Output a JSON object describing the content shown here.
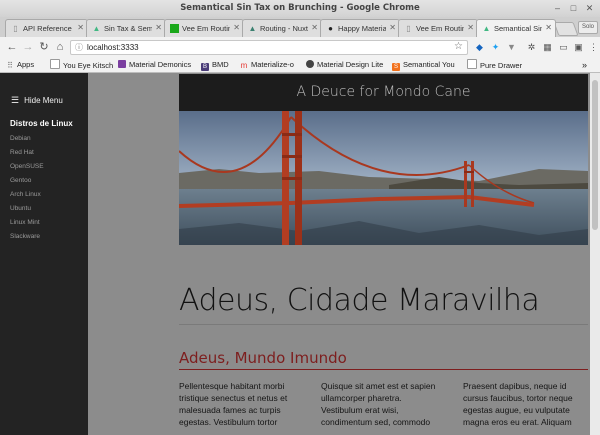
{
  "window": {
    "title": "Semantical Sin Tax on Brunching - Google Chrome"
  },
  "tabs": [
    {
      "label": "API Reference",
      "icon": "page-icon"
    },
    {
      "label": "Sin Tax & Semantics",
      "icon": "vue-icon"
    },
    {
      "label": "Vee Em Routing",
      "icon": "green-square-icon"
    },
    {
      "label": "Routing - Nuxt",
      "icon": "nuxt-icon"
    },
    {
      "label": "Happy Material",
      "icon": "github-icon"
    },
    {
      "label": "Vee Em Routing",
      "icon": "page-icon"
    },
    {
      "label": "Semantical Sin Tax",
      "icon": "vue-icon"
    }
  ],
  "profile_label": "Solo",
  "toolbar": {
    "url": "localhost:3333"
  },
  "bookmarks": [
    {
      "label": "Apps",
      "icon": "apps-grid-icon",
      "color": "#777777"
    },
    {
      "label": "You Eye Kitsch",
      "icon": "page-icon",
      "color": "#999999"
    },
    {
      "label": "Material Demonics",
      "icon": "material-icon",
      "color": "#7b3fa0"
    },
    {
      "label": "BMD",
      "icon": "bmd-icon",
      "color": "#4a3c78"
    },
    {
      "label": "Materialize-o",
      "icon": "materialize-icon",
      "color": "#e53935"
    },
    {
      "label": "Material Design Lite",
      "icon": "mdl-icon",
      "color": "#444444"
    },
    {
      "label": "Semantical You",
      "icon": "semantic-icon",
      "color": "#f2711c"
    },
    {
      "label": "Pure Drawer",
      "icon": "page-icon",
      "color": "#999999"
    }
  ],
  "sidebar": {
    "toggle_label": "Hide Menu",
    "heading": "Distros de Linux",
    "items": [
      "Debian",
      "Red Hat",
      "OpenSUSE",
      "Gentoo",
      "Arch Linux",
      "Ubuntu",
      "Linux Mint",
      "Slackware"
    ]
  },
  "hero": {
    "title": "A Deuce for Mondo Cane"
  },
  "main": {
    "heading": "Adeus, Cidade Maravilha",
    "subheading": "Adeus, Mundo Imundo",
    "columns": [
      "Pellentesque habitant morbi tristique senectus et netus et malesuada fames ac turpis egestas. Vestibulum tortor",
      "Quisque sit amet est et sapien ullamcorper pharetra. Vestibulum erat wisi, condimentum sed, commodo",
      "Praesent dapibus, neque id cursus faucibus, tortor neque egestas augue, eu vulputate magna eros eu erat. Aliquam"
    ]
  },
  "colors": {
    "accent": "#7d1e1e",
    "sidebar": "#232323",
    "overlay": "#8c8c8c"
  }
}
